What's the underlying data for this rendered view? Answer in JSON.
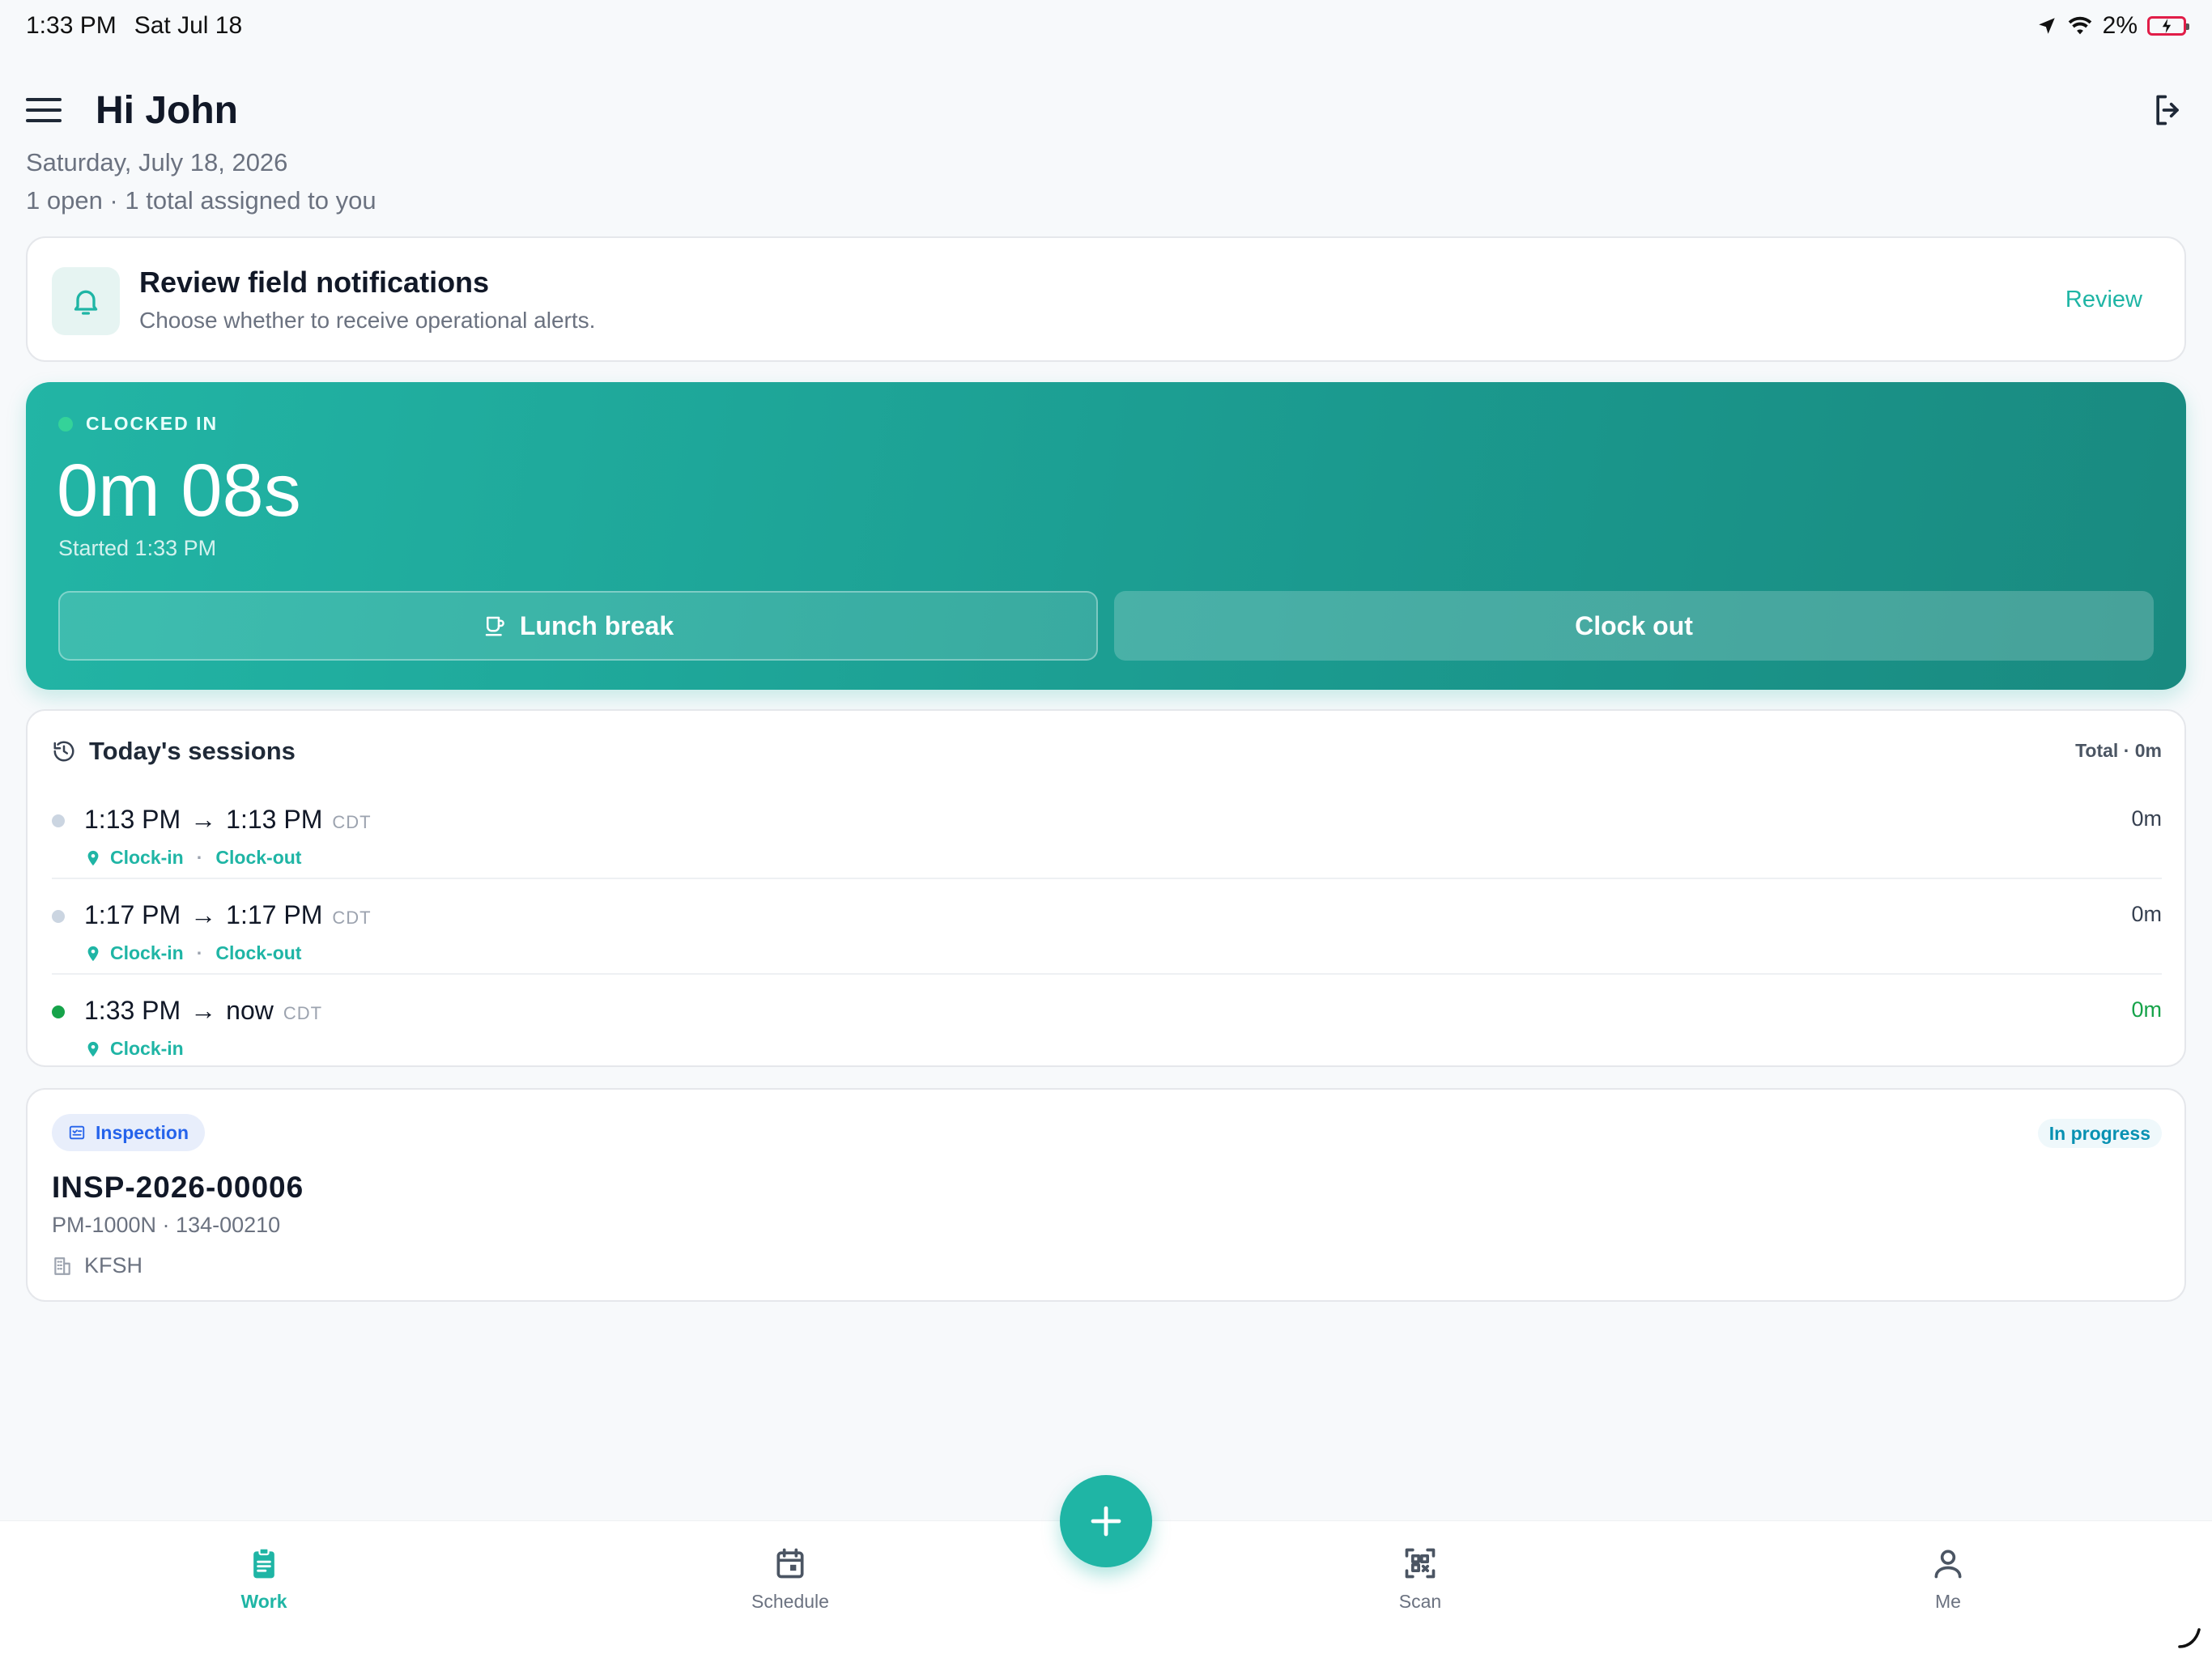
{
  "status_bar": {
    "time": "1:33 PM",
    "date": "Sat Jul 18",
    "battery": "2%"
  },
  "header": {
    "title": "Hi John"
  },
  "date_line": "Saturday, July 18, 2026",
  "summary_line": "1 open · 1 total assigned to you",
  "notification": {
    "title": "Review field notifications",
    "subtitle": "Choose whether to receive operational alerts.",
    "action": "Review"
  },
  "clock": {
    "status": "CLOCKED IN",
    "timer": "0m 08s",
    "started": "Started 1:33 PM",
    "lunch_label": "Lunch break",
    "clockout_label": "Clock out"
  },
  "sessions": {
    "title": "Today's sessions",
    "total": "Total · 0m",
    "rows": [
      {
        "start": "1:13 PM",
        "arrow": "→",
        "end": "1:13 PM",
        "tz": "CDT",
        "tag_in": "Clock-in",
        "sep": "·",
        "tag_out": "Clock-out",
        "duration": "0m"
      },
      {
        "start": "1:17 PM",
        "arrow": "→",
        "end": "1:17 PM",
        "tz": "CDT",
        "tag_in": "Clock-in",
        "sep": "·",
        "tag_out": "Clock-out",
        "duration": "0m"
      },
      {
        "start": "1:33 PM",
        "arrow": "→",
        "end": "now",
        "tz": "CDT",
        "tag_in": "Clock-in",
        "duration": "0m"
      }
    ]
  },
  "inspection": {
    "type": "Inspection",
    "status": "In progress",
    "code": "INSP-2026-00006",
    "meta": "PM-1000N · 134-00210",
    "site": "KFSH"
  },
  "tabs": {
    "work": "Work",
    "schedule": "Schedule",
    "scan": "Scan",
    "me": "Me"
  },
  "colors": {
    "accent": "#1fb5a5",
    "active_dot": "#16a34a",
    "badge_blue": "#2563eb"
  },
  "icons": [
    "location-arrow-icon",
    "wifi-icon",
    "battery-charging-icon",
    "menu-icon",
    "logout-icon",
    "bell-icon",
    "coffee-cup-icon",
    "history-icon",
    "map-pin-icon",
    "inspection-icon",
    "building-icon",
    "clipboard-icon",
    "calendar-icon",
    "qr-scan-icon",
    "person-icon",
    "plus-icon"
  ]
}
